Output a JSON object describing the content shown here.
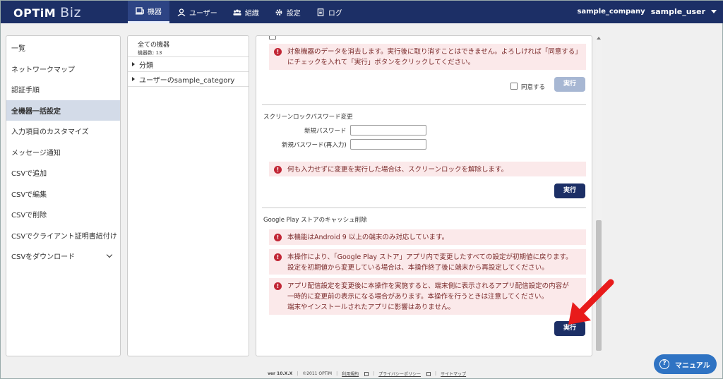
{
  "header": {
    "logo": "OPTiM",
    "logo_sub": "Biz",
    "nav": [
      {
        "label": "機器",
        "icon": "device-icon",
        "active": true
      },
      {
        "label": "ユーザー",
        "icon": "user-icon",
        "active": false
      },
      {
        "label": "組織",
        "icon": "org-icon",
        "active": false
      },
      {
        "label": "設定",
        "icon": "gear-icon",
        "active": false
      },
      {
        "label": "ログ",
        "icon": "log-icon",
        "active": false
      }
    ],
    "company": "sample_company",
    "user": "sample_user"
  },
  "sidebar": {
    "items": [
      {
        "label": "一覧"
      },
      {
        "label": "ネットワークマップ"
      },
      {
        "label": "認証手順"
      },
      {
        "label": "全機器一括設定",
        "active": true
      },
      {
        "label": "入力項目のカスタマイズ"
      },
      {
        "label": "メッセージ通知"
      },
      {
        "label": "CSVで追加"
      },
      {
        "label": "CSVで編集"
      },
      {
        "label": "CSVで削除"
      },
      {
        "label": "CSVでクライアント証明書紐付け"
      },
      {
        "label": "CSVをダウンロード"
      }
    ]
  },
  "tree": {
    "root_label": "全ての機器",
    "root_count": "機器数: 13",
    "nodes": [
      {
        "label": "分類"
      },
      {
        "label": "ユーザーのsample_category"
      }
    ]
  },
  "main": {
    "wipe": {
      "warning": "対象機器のデータを消去します。実行後に取り消すことはできません。よろしければ「同意する」にチェックを入れて「実行」ボタンをクリックしてください。",
      "agree_label": "同意する",
      "execute_label": "実行"
    },
    "lock": {
      "title": "スクリーンロックパスワード変更",
      "new_pw_label": "新規パスワード",
      "new_pw_confirm_label": "新規パスワード(再入力)",
      "warning": "何も入力せずに変更を実行した場合は、スクリーンロックを解除します。",
      "execute_label": "実行"
    },
    "gplay": {
      "title": "Google Play ストアのキャッシュ削除",
      "warning1": "本機能はAndroid 9 以上の端末のみ対応しています。",
      "warning2_line1": "本操作により、「Google Play ストア」アプリ内で変更したすべての設定が初期値に戻ります。",
      "warning2_line2": "設定を初期値から変更している場合は、本操作終了後に端末から再設定してください。",
      "warning3_line1": "アプリ配信設定を変更後に本操作を実施すると、端末側に表示されるアプリ配信設定の内容が",
      "warning3_line2": "一時的に変更前の表示になる場合があります。本操作を行うときは注意してください。",
      "warning3_line3": "端末やインストールされたアプリに影響はありません。",
      "execute_label": "実行"
    }
  },
  "footer": {
    "version": "ver 10.X.X",
    "copyright": "©2011 OPTiM",
    "terms": "利用規約",
    "privacy": "プライバシーポリシー",
    "sitemap": "サイトマップ"
  },
  "manual_label": "マニュアル",
  "colors": {
    "header_bg": "#1c2f66",
    "warning_bg": "#fbe9ea",
    "warning_icon": "#c12635",
    "arrow": "#e81b1b",
    "manual_bg": "#2f73c3"
  }
}
